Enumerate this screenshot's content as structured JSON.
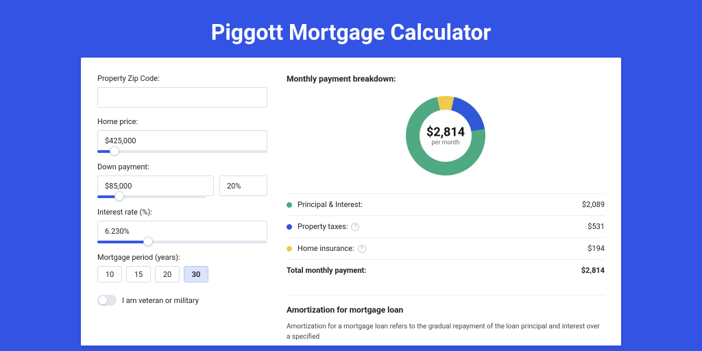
{
  "title": "Piggott Mortgage Calculator",
  "form": {
    "zip_label": "Property Zip Code:",
    "zip_value": "",
    "price_label": "Home price:",
    "price_value": "$425,000",
    "price_slider_pct": 10,
    "dp_label": "Down payment:",
    "dp_value": "$85,000",
    "dp_pct_value": "20%",
    "dp_slider_pct": 20,
    "rate_label": "Interest rate (%):",
    "rate_value": "6.230%",
    "rate_slider_pct": 30,
    "period_label": "Mortgage period (years):",
    "periods": [
      "10",
      "15",
      "20",
      "30"
    ],
    "period_active": "30",
    "vet_label": "I am veteran or military"
  },
  "breakdown": {
    "title": "Monthly payment breakdown:",
    "center_amount": "$2,814",
    "center_label": "per month",
    "items": [
      {
        "name": "Principal & Interest:",
        "value": "$2,089",
        "color": "#4fa982",
        "info": false
      },
      {
        "name": "Property taxes:",
        "value": "$531",
        "color": "#2f58d6",
        "info": true
      },
      {
        "name": "Home insurance:",
        "value": "$194",
        "color": "#f0c94f",
        "info": true
      }
    ],
    "total_label": "Total monthly payment:",
    "total_value": "$2,814"
  },
  "chart_data": {
    "type": "pie",
    "title": "Monthly payment breakdown",
    "categories": [
      "Principal & Interest",
      "Property taxes",
      "Home insurance"
    ],
    "values": [
      2089,
      531,
      194
    ],
    "colors": [
      "#4fa982",
      "#2f58d6",
      "#f0c94f"
    ]
  },
  "amort": {
    "title": "Amortization for mortgage loan",
    "text": "Amortization for a mortgage loan refers to the gradual repayment of the loan principal and interest over a specified"
  }
}
